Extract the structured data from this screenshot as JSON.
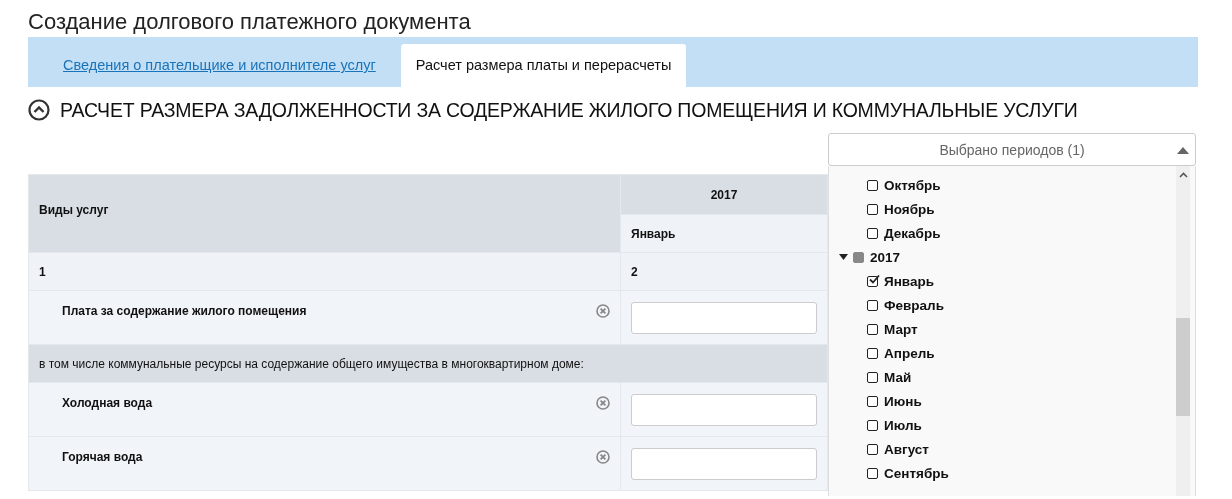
{
  "page_title": "Создание долгового платежного документа",
  "tabs": [
    {
      "label": "Сведения о плательщике и исполнителе услуг",
      "selected": false
    },
    {
      "label": "Расчет размера платы и перерасчеты",
      "selected": true
    }
  ],
  "section": {
    "title": "РАСЧЕТ РАЗМЕРА ЗАДОЛЖЕННОСТИ ЗА СОДЕРЖАНИЕ ЖИЛОГО ПОМЕЩЕНИЯ И КОММУНАЛЬНЫЕ УСЛУГИ",
    "expanded": true
  },
  "period_select": {
    "label": "Выбрано периодов (1)",
    "open": true,
    "items": [
      {
        "kind": "month",
        "label": "Октябрь",
        "checked": false
      },
      {
        "kind": "month",
        "label": "Ноябрь",
        "checked": false
      },
      {
        "kind": "month",
        "label": "Декабрь",
        "checked": false
      },
      {
        "kind": "year",
        "label": "2017",
        "expanded": true,
        "mixed": true,
        "children": [
          {
            "kind": "month",
            "label": "Январь",
            "checked": true
          },
          {
            "kind": "month",
            "label": "Февраль",
            "checked": false
          },
          {
            "kind": "month",
            "label": "Март",
            "checked": false
          },
          {
            "kind": "month",
            "label": "Апрель",
            "checked": false
          },
          {
            "kind": "month",
            "label": "Май",
            "checked": false
          },
          {
            "kind": "month",
            "label": "Июнь",
            "checked": false
          },
          {
            "kind": "month",
            "label": "Июль",
            "checked": false
          },
          {
            "kind": "month",
            "label": "Август",
            "checked": false
          },
          {
            "kind": "month",
            "label": "Сентябрь",
            "checked": false
          }
        ]
      }
    ]
  },
  "table": {
    "service_header": "Виды услуг",
    "year": "2017",
    "month": "Январь",
    "column_numbers": [
      "1",
      "2"
    ],
    "rows": [
      {
        "kind": "service",
        "name": "Плата за содержание жилого помещения"
      },
      {
        "kind": "group",
        "name": "в том числе коммунальные ресурсы на содержание общего имущества в многоквартирном доме:"
      },
      {
        "kind": "service",
        "name": "Холодная вода"
      },
      {
        "kind": "service",
        "name": "Горячая вода"
      }
    ]
  }
}
